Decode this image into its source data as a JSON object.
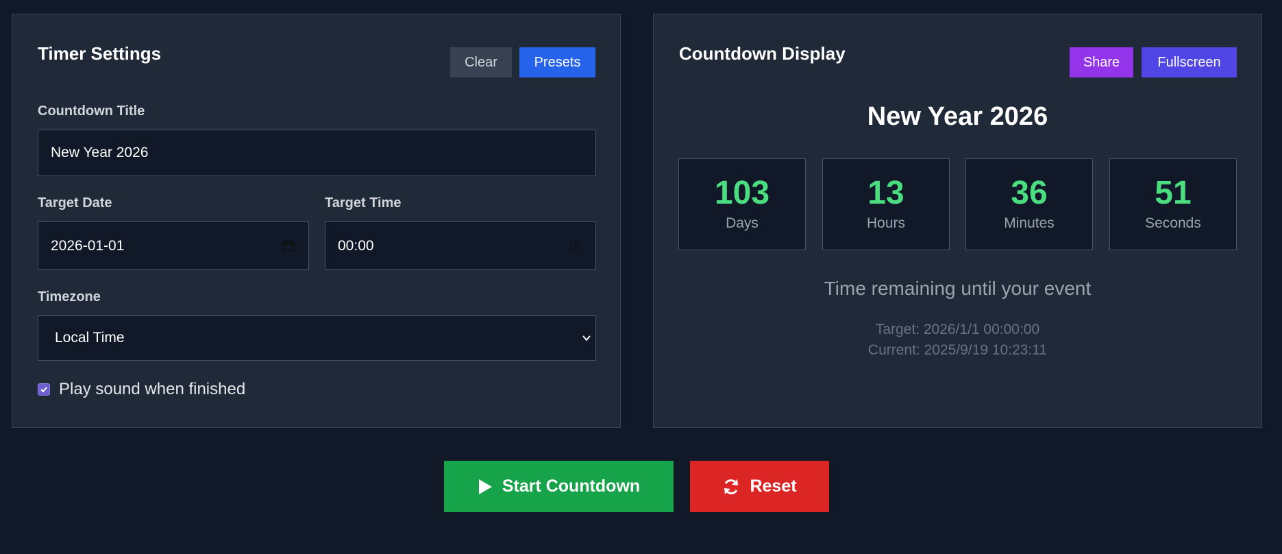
{
  "settings": {
    "title": "Timer Settings",
    "clear_label": "Clear",
    "presets_label": "Presets",
    "countdown_title_label": "Countdown Title",
    "countdown_title_value": "New Year 2026",
    "target_date_label": "Target Date",
    "target_date_value": "2026-01-01",
    "target_time_label": "Target Time",
    "target_time_value": "00:00",
    "timezone_label": "Timezone",
    "timezone_value": "Local Time",
    "sound_checked": true,
    "sound_label": "Play sound when finished"
  },
  "display": {
    "title": "Countdown Display",
    "share_label": "Share",
    "fullscreen_label": "Fullscreen",
    "event_title": "New Year 2026",
    "units": [
      {
        "value": "103",
        "label": "Days"
      },
      {
        "value": "13",
        "label": "Hours"
      },
      {
        "value": "36",
        "label": "Minutes"
      },
      {
        "value": "51",
        "label": "Seconds"
      }
    ],
    "remaining_text": "Time remaining until your event",
    "target_text": "Target: 2026/1/1 00:00:00",
    "current_text": "Current: 2025/9/19 10:23:11"
  },
  "actions": {
    "start_label": "Start Countdown",
    "reset_label": "Reset"
  },
  "colors": {
    "background": "#111827",
    "panel": "#1f2937",
    "accent_green": "#4ade80",
    "presets_blue": "#2563eb",
    "share_purple": "#9333ea",
    "fullscreen_indigo": "#4f46e5",
    "start_green": "#16a34a",
    "reset_red": "#dc2626"
  },
  "icons": {
    "calendar": "calendar-icon",
    "clock": "clock-icon",
    "chevron": "chevron-down-icon",
    "play": "play-icon",
    "reset": "refresh-icon",
    "check": "check-icon"
  }
}
